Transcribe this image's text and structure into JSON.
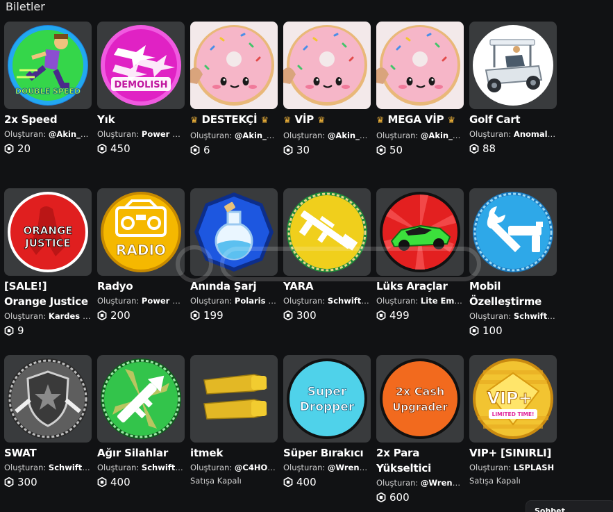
{
  "section": {
    "title": "Biletler"
  },
  "creator_prefix": "Oluşturan:",
  "items": [
    {
      "name": "2x Speed",
      "creator": "@Akin_TR",
      "price": "20",
      "icon": "runner-double-speed-icon",
      "thumb_text": "DOUBLE SPEED",
      "bg": "#3fdc4a"
    },
    {
      "name": "Yık",
      "creator": "Power Si...",
      "price": "450",
      "icon": "demolish-jets-icon",
      "thumb_text": "DEMOLISH",
      "bg": "#e228c8"
    },
    {
      "name": "DESTEKÇİ",
      "crowned": true,
      "creator": "@Akin_TR",
      "price": "6",
      "icon": "donut-face-icon",
      "bg": "#f4b8c9"
    },
    {
      "name": "VİP",
      "crowned": true,
      "creator": "@Akin_TR",
      "price": "30",
      "icon": "donut-face-icon",
      "bg": "#f4b8c9"
    },
    {
      "name": "MEGA VİP",
      "crowned": true,
      "creator": "@Akin_TR",
      "price": "50",
      "icon": "donut-face-icon",
      "bg": "#f4b8c9"
    },
    {
      "name": "Golf Cart",
      "creator": "Anomaly ...",
      "price": "88",
      "icon": "golf-cart-icon",
      "bg": "#ffffff"
    },
    {
      "name": "[SALE!] Orange Justice",
      "creator": "Kardes St...",
      "price": "9",
      "icon": "dancer-orange-justice-icon",
      "thumb_text": "ORANGE JUSTICE",
      "bg": "#e21d1d"
    },
    {
      "name": "Radyo",
      "creator": "Power Si...",
      "price": "200",
      "icon": "radio-boombox-icon",
      "thumb_text": "RADIO",
      "bg": "#f5b400"
    },
    {
      "name": "Anında Şarj",
      "creator": "Polaris St...",
      "price": "199",
      "icon": "potion-flask-icon",
      "bg": "#1a4fd6"
    },
    {
      "name": "YARA",
      "creator": "Schwifty ...",
      "price": "300",
      "icon": "rifle-icon",
      "bg": "#f0cf1c"
    },
    {
      "name": "Lüks Araçlar",
      "creator": "Lite Empire",
      "price": "499",
      "icon": "sports-car-icon",
      "bg": "#e02222"
    },
    {
      "name": "Mobil Özelleştirme",
      "creator": "Schwifty ...",
      "price": "100",
      "icon": "wrench-gun-icon",
      "bg": "#2aa6e6"
    },
    {
      "name": "SWAT",
      "creator": "Schwifty ...",
      "price": "300",
      "icon": "swat-shield-icon",
      "bg": "#5a5a5a"
    },
    {
      "name": "Ağır Silahlar",
      "creator": "Schwifty ...",
      "price": "400",
      "icon": "bazooka-icon",
      "bg": "#2fc24a"
    },
    {
      "name": "itmek",
      "creator": "@C4HOd...",
      "offsale": "Satışa Kapalı",
      "icon": "golden-fists-icon",
      "bg": "#393b3d"
    },
    {
      "name": "Süper Bırakıcı",
      "creator": "@Wrench...",
      "price": "400",
      "icon": "super-dropper-icon",
      "thumb_text": "Super Dropper",
      "bg": "#4ed0e8"
    },
    {
      "name": "2x Para Yükseltici",
      "creator": "@Wrench...",
      "price": "600",
      "icon": "cash-upgrader-icon",
      "thumb_text": "2x Cash Upgrader",
      "bg": "#f06a1e"
    },
    {
      "name": "VIP+ [SINIRLI]",
      "creator": "LSPLASH",
      "offsale": "Satışa Kapalı",
      "icon": "vip-plus-icon",
      "thumb_text": "VIP+",
      "thumb_subtext": "LIMITED TIME!",
      "bg": "#f2c230"
    }
  ],
  "chat": {
    "label": "Sohbet"
  }
}
